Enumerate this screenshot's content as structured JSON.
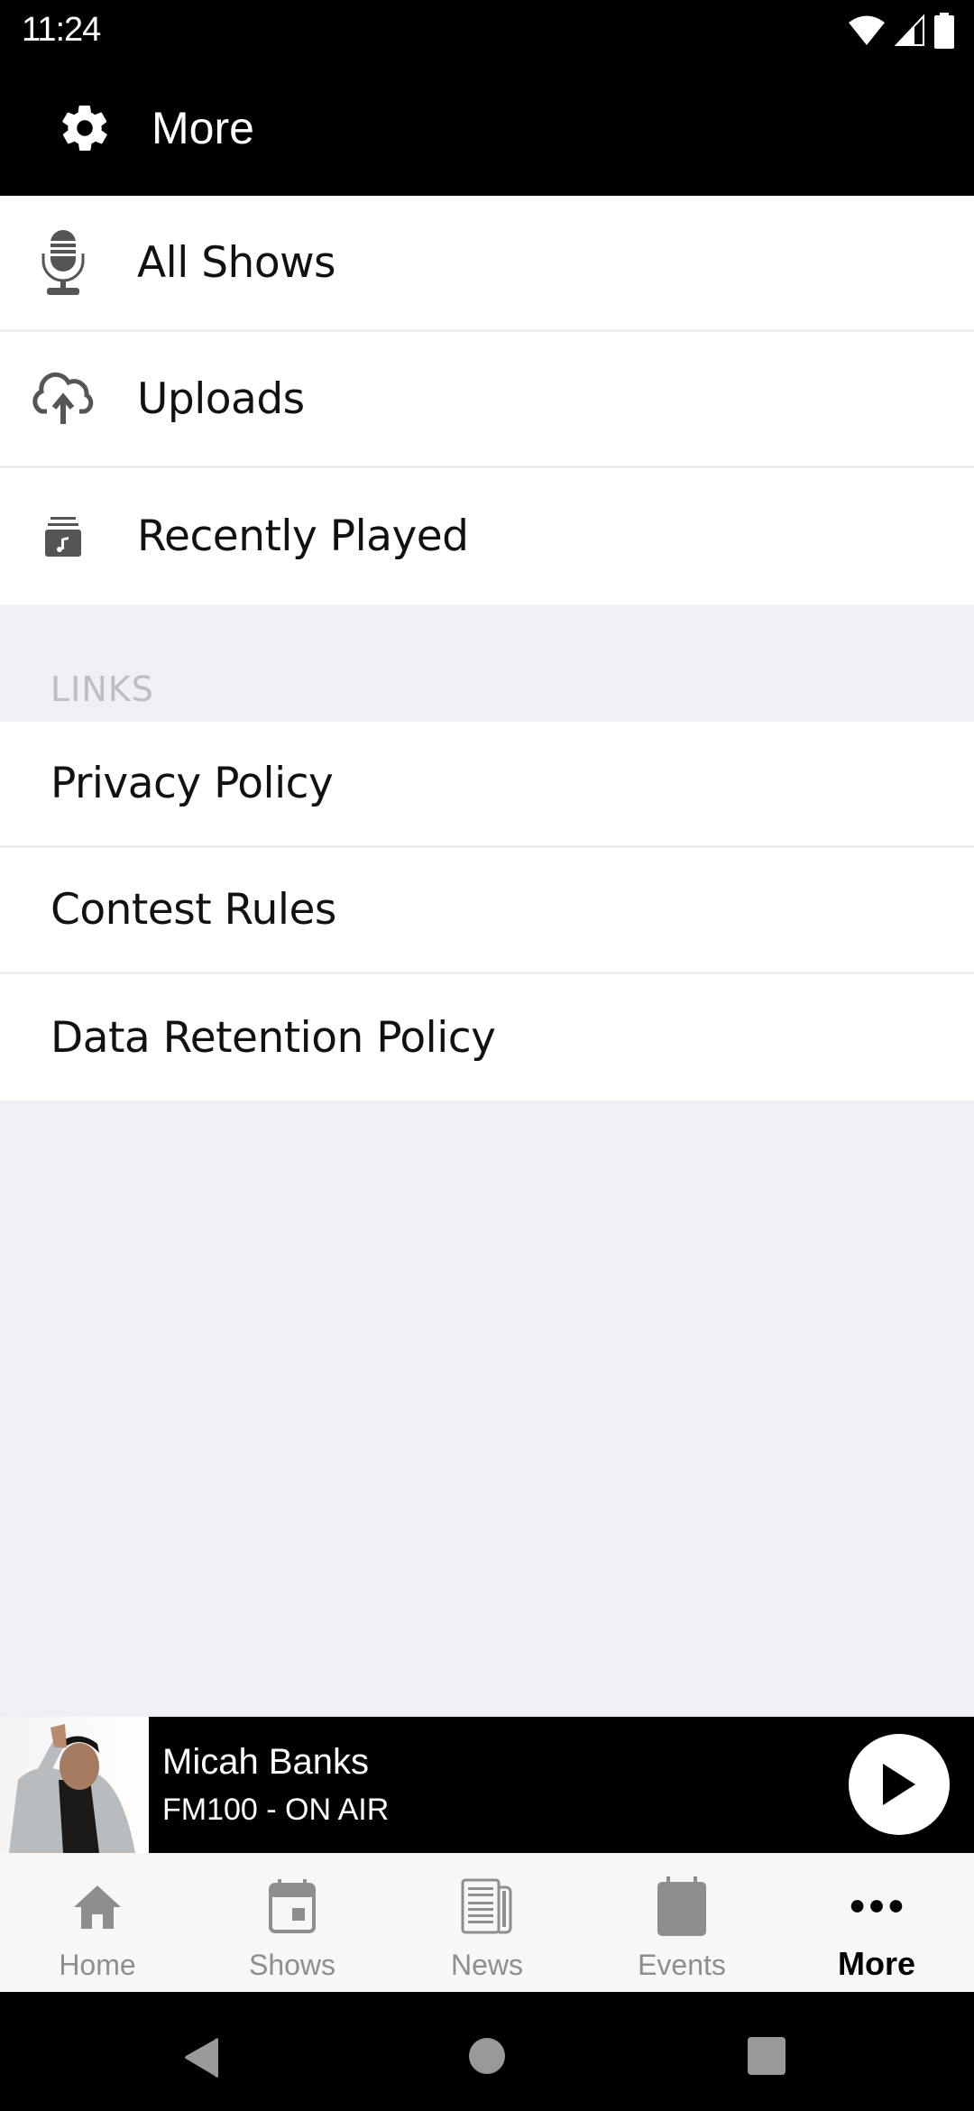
{
  "status_bar": {
    "time": "11:24",
    "icons": [
      "wifi-icon",
      "cell-signal-icon",
      "battery-icon"
    ]
  },
  "header": {
    "icon": "gear-icon",
    "title": "More"
  },
  "menu": {
    "items": [
      {
        "icon": "microphone-icon",
        "label": "All Shows"
      },
      {
        "icon": "cloud-upload-icon",
        "label": "Uploads"
      },
      {
        "icon": "music-library-icon",
        "label": "Recently Played"
      }
    ]
  },
  "links": {
    "section_title": "LINKS",
    "items": [
      {
        "label": "Privacy Policy"
      },
      {
        "label": "Contest Rules"
      },
      {
        "label": "Data Retention Policy"
      }
    ]
  },
  "player": {
    "title": "Micah Banks",
    "subtitle": "FM100 - ON AIR",
    "state": "paused",
    "action_icon": "play-icon"
  },
  "tabs": [
    {
      "icon": "home-icon",
      "label": "Home",
      "active": false
    },
    {
      "icon": "calendar-icon",
      "label": "Shows",
      "active": false
    },
    {
      "icon": "newspaper-icon",
      "label": "News",
      "active": false
    },
    {
      "icon": "calendar-icon",
      "label": "Events",
      "active": false
    },
    {
      "icon": "more-dots-icon",
      "label": "More",
      "active": true
    }
  ],
  "colors": {
    "header_bg": "#000000",
    "list_bg": "#ffffff",
    "page_bg": "#efeff4",
    "icon_gray": "#555555",
    "tab_inactive": "#8e8e8e",
    "tab_active": "#000000",
    "section_label": "#bdbdc2"
  },
  "system_nav": {
    "buttons": [
      "back",
      "home",
      "recents"
    ]
  }
}
